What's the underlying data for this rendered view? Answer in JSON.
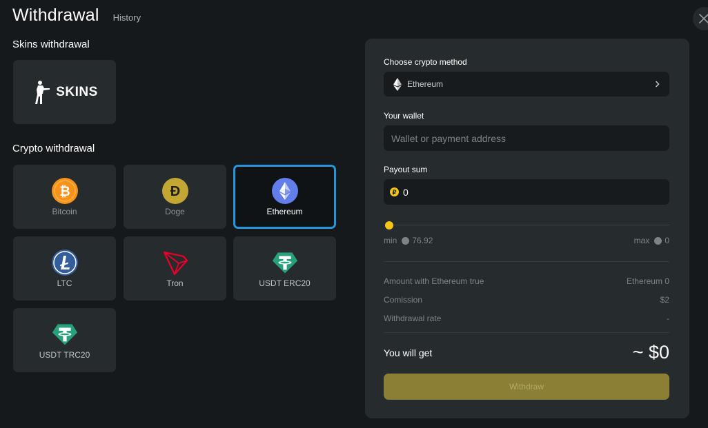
{
  "header": {
    "title": "Withdrawal",
    "history_label": "History"
  },
  "skins_section": {
    "title": "Skins withdrawal",
    "card_label": "SKINS"
  },
  "crypto_section": {
    "title": "Crypto withdrawal",
    "methods": [
      {
        "label": "Bitcoin",
        "icon": "bitcoin-icon"
      },
      {
        "label": "Doge",
        "icon": "doge-icon"
      },
      {
        "label": "Ethereum",
        "icon": "ethereum-icon",
        "selected": true
      },
      {
        "label": "LTC",
        "icon": "litecoin-icon"
      },
      {
        "label": "Tron",
        "icon": "tron-icon"
      },
      {
        "label": "USDT ERC20",
        "icon": "tether-icon"
      },
      {
        "label": "USDT TRC20",
        "icon": "tether-icon"
      }
    ]
  },
  "panel": {
    "method_label": "Choose crypto method",
    "method_value": "Ethereum",
    "wallet_label": "Your wallet",
    "wallet_placeholder": "Wallet or payment address",
    "wallet_value": "",
    "payout_label": "Payout sum",
    "payout_value": "0",
    "min_label": "min",
    "min_value": "76.92",
    "max_label": "max",
    "max_value": "0",
    "slider_position": 0,
    "amount_label": "Amount with Ethereum true",
    "amount_value": "Ethereum 0",
    "commission_label": "Comission",
    "commission_value": "$2",
    "rate_label": "Withdrawal rate",
    "rate_value": "-",
    "get_label": "You will get",
    "get_value": "~ $0",
    "withdraw_label": "Withdraw"
  },
  "colors": {
    "background": "#15191b",
    "card": "#262b2e",
    "selected_border": "#2795d9",
    "accent_yellow": "#f5c518",
    "withdraw_button": "#8a7f34"
  }
}
